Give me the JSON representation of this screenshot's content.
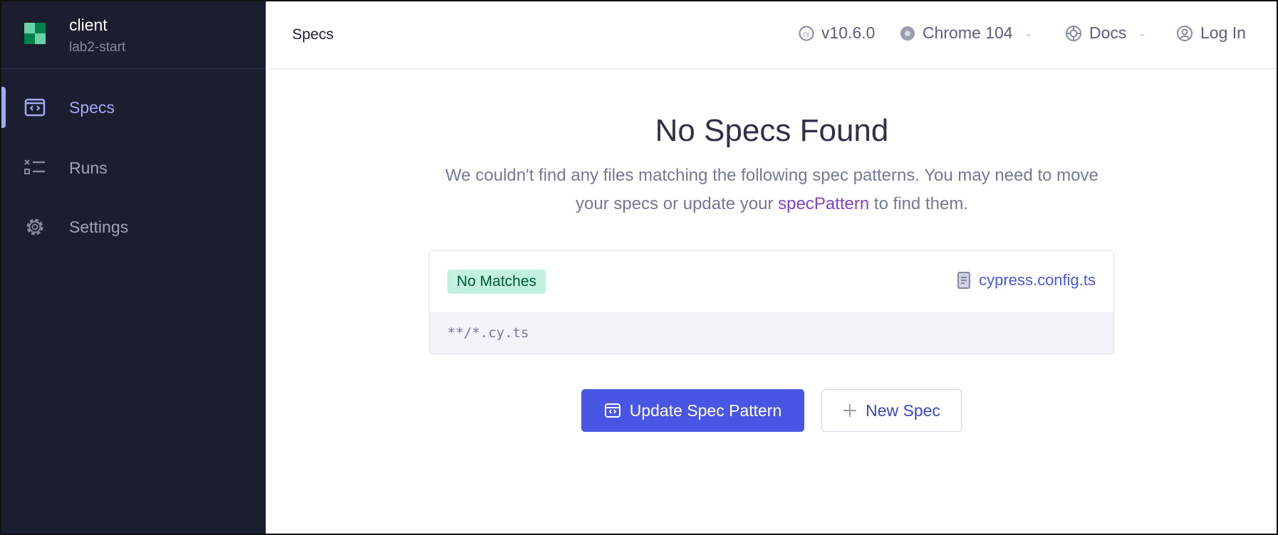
{
  "project": {
    "name": "client",
    "branch": "lab2-start"
  },
  "sidebar": {
    "items": [
      {
        "label": "Specs",
        "icon": "code-window-icon",
        "active": true
      },
      {
        "label": "Runs",
        "icon": "runs-list-icon"
      },
      {
        "label": "Settings",
        "icon": "gear-icon"
      }
    ]
  },
  "header": {
    "breadcrumb": "Specs",
    "version": "v10.6.0",
    "browser": "Chrome 104",
    "docs": "Docs",
    "login": "Log In"
  },
  "main": {
    "title": "No Specs Found",
    "description_before": "We couldn't find any files matching the following spec patterns. You may need to move your specs or update your ",
    "description_link": "specPattern",
    "description_after": " to find them.",
    "card": {
      "badge": "No Matches",
      "config_file": "cypress.config.ts",
      "pattern": "**/*.cy.ts"
    },
    "buttons": {
      "update": "Update Spec Pattern",
      "new_spec": "New Spec"
    }
  },
  "colors": {
    "sidebar": "#1b1e2e",
    "accent": "#4956e3",
    "link": "#7f43c9",
    "badge_bg": "#c2f1de",
    "badge_text": "#00592f"
  }
}
